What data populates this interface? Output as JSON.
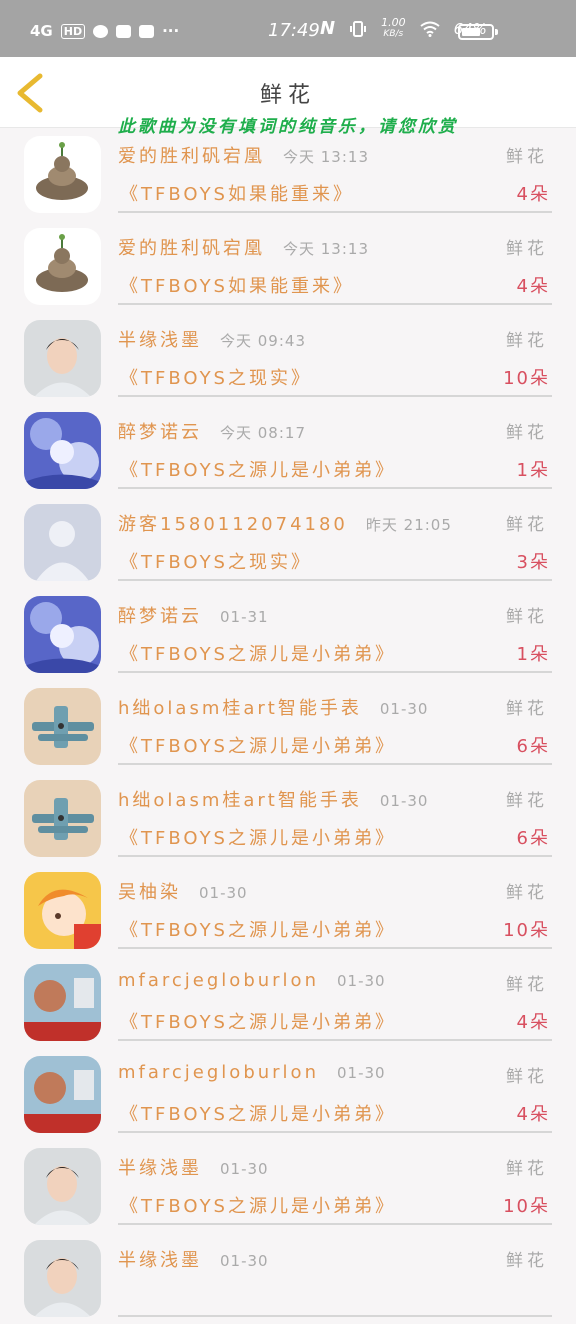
{
  "status_bar": {
    "network": "4G",
    "hd": "HD",
    "more": "···",
    "time": "17:49",
    "nfc": "N",
    "speed": "1.00",
    "speed_unit": "KB/s",
    "battery_text": "64%",
    "battery_level": 0.64
  },
  "header": {
    "title": "鲜花",
    "notice": "此歌曲为没有填词的纯音乐，请您欣赏"
  },
  "flower_label": "鲜花",
  "rows": [
    {
      "name": "爱的胜利矾宕凰",
      "time": "今天 13:13",
      "song": "《TFBOYS如果能重来》",
      "count": "4朵",
      "avatar": "cat-avatar"
    },
    {
      "name": "爱的胜利矾宕凰",
      "time": "今天 13:13",
      "song": "《TFBOYS如果能重来》",
      "count": "4朵",
      "avatar": "cat-avatar"
    },
    {
      "name": "半缘浅墨",
      "time": "今天 09:43",
      "song": "《TFBOYS之现实》",
      "count": "10朵",
      "avatar": "boy-avatar"
    },
    {
      "name": "醉梦诺云",
      "time": "今天 08:17",
      "song": "《TFBOYS之源儿是小弟弟》",
      "count": "1朵",
      "avatar": "anime-avatar"
    },
    {
      "name": "游客1580112074180",
      "time": "昨天 21:05",
      "song": "《TFBOYS之现实》",
      "count": "3朵",
      "avatar": "default-avatar"
    },
    {
      "name": "醉梦诺云",
      "time": "01-31",
      "song": "《TFBOYS之源儿是小弟弟》",
      "count": "1朵",
      "avatar": "anime-avatar"
    },
    {
      "name": "h绌olasm桂art智能手表",
      "time": "01-30",
      "song": "《TFBOYS之源儿是小弟弟》",
      "count": "6朵",
      "avatar": "plane-avatar"
    },
    {
      "name": "h绌olasm桂art智能手表",
      "time": "01-30",
      "song": "《TFBOYS之源儿是小弟弟》",
      "count": "6朵",
      "avatar": "plane-avatar"
    },
    {
      "name": "吴柚染",
      "time": "01-30",
      "song": "《TFBOYS之源儿是小弟弟》",
      "count": "10朵",
      "avatar": "cartoon-avatar"
    },
    {
      "name": "mfarcjegloburlon",
      "time": "01-30",
      "song": "《TFBOYS之源儿是小弟弟》",
      "count": "4朵",
      "avatar": "photo-avatar"
    },
    {
      "name": "mfarcjegloburlon",
      "time": "01-30",
      "song": "《TFBOYS之源儿是小弟弟》",
      "count": "4朵",
      "avatar": "photo-avatar"
    },
    {
      "name": "半缘浅墨",
      "time": "01-30",
      "song": "《TFBOYS之源儿是小弟弟》",
      "count": "10朵",
      "avatar": "boy-avatar"
    },
    {
      "name": "半缘浅墨",
      "time": "01-30",
      "song": "",
      "count": "",
      "avatar": "boy-avatar"
    }
  ],
  "colors": {
    "status_bar": "#a4a4a4",
    "name_text": "#e0954f",
    "count_text": "#d85060",
    "notice_text": "#1fae4c",
    "back_arrow": "#e8b930"
  }
}
